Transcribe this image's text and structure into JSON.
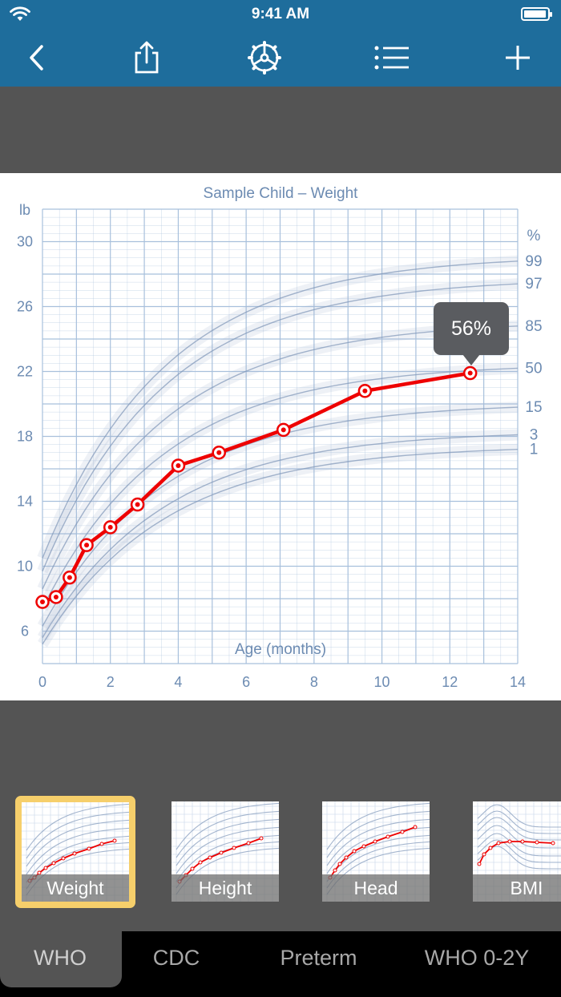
{
  "status": {
    "time": "9:41 AM",
    "battery_level": 0.95
  },
  "toolbar": {
    "back_icon": "chevron-left-icon",
    "share_icon": "share-icon",
    "settings_icon": "gear-icon",
    "list_icon": "list-icon",
    "add_icon": "plus-icon"
  },
  "colors": {
    "toolbar": "#1e6d9c",
    "series": "#ee0000",
    "grid": "#a8c0dc",
    "axis_text": "#6c8bb2",
    "selected_border": "#f6cf6b"
  },
  "chart_data": {
    "type": "line",
    "title": "Sample Child – Weight",
    "xlabel": "Age (months)",
    "ylabel": "lb",
    "right_label": "%",
    "xlim": [
      0,
      14
    ],
    "ylim": [
      4,
      32
    ],
    "x_ticks": [
      "0",
      "2",
      "4",
      "6",
      "8",
      "10",
      "12",
      "14"
    ],
    "y_ticks": [
      "6",
      "10",
      "14",
      "18",
      "22",
      "26",
      "30"
    ],
    "percentile_labels": [
      "99",
      "97",
      "85",
      "50",
      "15",
      "3",
      "1"
    ],
    "grid": true,
    "series": [
      {
        "values": [
          {
            "x": 0.0,
            "y": 7.8
          },
          {
            "x": 0.4,
            "y": 8.1
          },
          {
            "x": 0.8,
            "y": 9.3
          },
          {
            "x": 1.3,
            "y": 11.3
          },
          {
            "x": 2.0,
            "y": 12.4
          },
          {
            "x": 2.8,
            "y": 13.8
          },
          {
            "x": 4.0,
            "y": 16.2
          },
          {
            "x": 5.2,
            "y": 17.0
          },
          {
            "x": 7.1,
            "y": 18.4
          },
          {
            "x": 9.5,
            "y": 20.8
          },
          {
            "x": 12.6,
            "y": 21.9
          }
        ]
      }
    ],
    "annotation": {
      "text": "56%",
      "point_index": 10
    }
  },
  "thumbnails": [
    {
      "label": "Weight",
      "selected": true
    },
    {
      "label": "Height",
      "selected": false
    },
    {
      "label": "Head",
      "selected": false
    },
    {
      "label": "BMI",
      "selected": false
    }
  ],
  "tabs": [
    {
      "label": "WHO",
      "active": true
    },
    {
      "label": "CDC",
      "active": false
    },
    {
      "label": "Preterm",
      "active": false
    },
    {
      "label": "WHO 0-2Y",
      "active": false
    }
  ]
}
